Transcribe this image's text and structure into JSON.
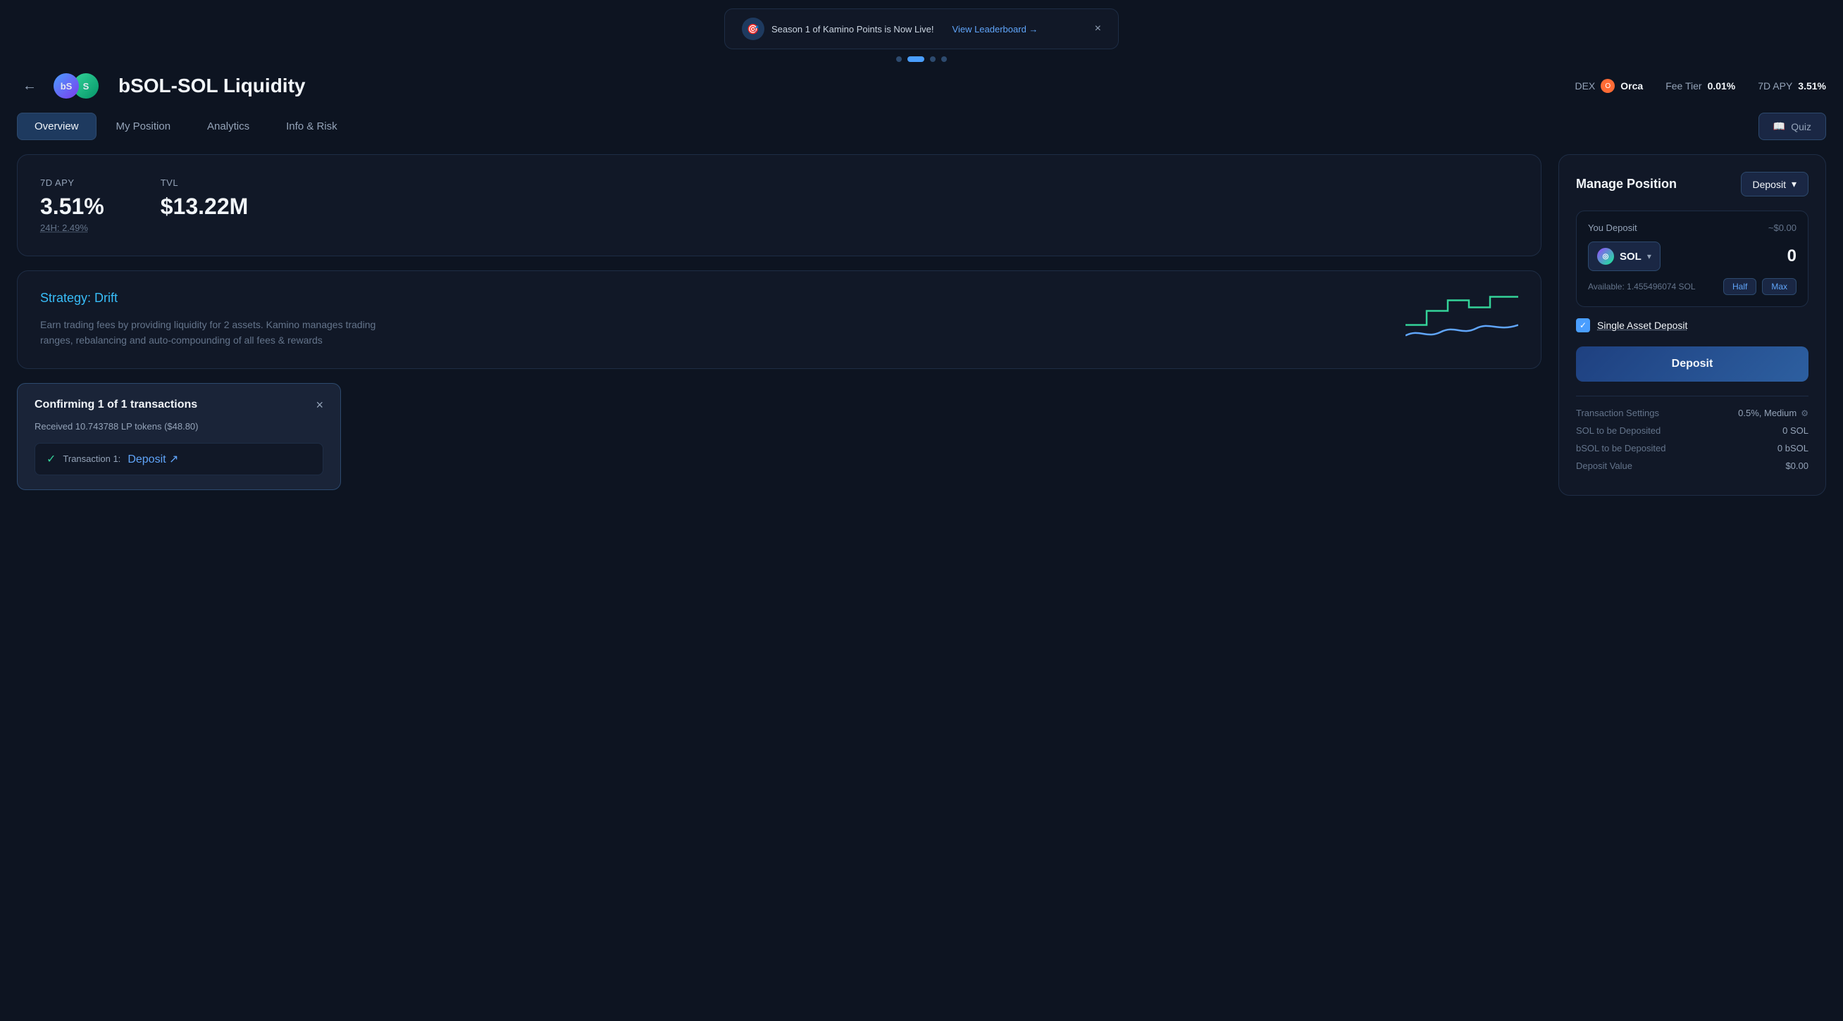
{
  "banner": {
    "text": "Season 1 of Kamino Points is Now Live!",
    "link_text": "View Leaderboard →",
    "close_label": "×",
    "icon": "🎯"
  },
  "dots": [
    {
      "active": false
    },
    {
      "active": true
    },
    {
      "active": false
    },
    {
      "active": false
    }
  ],
  "header": {
    "back_label": "←",
    "pool_title": "bSOL-SOL Liquidity",
    "dex_label": "DEX",
    "dex_name": "Orca",
    "fee_tier_label": "Fee Tier",
    "fee_tier_value": "0.01%",
    "apy_label": "7D APY",
    "apy_value": "3.51%"
  },
  "nav": {
    "tabs": [
      {
        "label": "Overview",
        "active": true
      },
      {
        "label": "My Position",
        "active": false
      },
      {
        "label": "Analytics",
        "active": false
      },
      {
        "label": "Info & Risk",
        "active": false
      }
    ],
    "quiz_label": "Quiz"
  },
  "stats": {
    "apy_label": "7D APY",
    "apy_value": "3.51%",
    "apy_sub": "24H: 2.49%",
    "tvl_label": "TVL",
    "tvl_value": "$13.22M"
  },
  "strategy": {
    "title_prefix": "Strategy: ",
    "title_highlight": "Drift",
    "description": "Earn trading fees by providing liquidity for 2 assets. Kamino manages trading ranges, rebalancing and\nauto-compounding of all fees & rewards"
  },
  "confirm_modal": {
    "title": "Confirming 1 of 1 transactions",
    "close_label": "×",
    "subtitle": "Received 10.743788 LP tokens ($48.80)",
    "tx_check": "✓",
    "tx_label": "Transaction 1:",
    "tx_link": "Deposit",
    "tx_arrow": "↗"
  },
  "manage_position": {
    "title": "Manage Position",
    "dropdown_label": "Deposit",
    "dropdown_arrow": "▾",
    "deposit_section": {
      "label": "You Deposit",
      "usd_value": "~$0.00",
      "token_name": "SOL",
      "amount": "0",
      "available_label": "Available: 1.455496074 SOL",
      "half_label": "Half",
      "max_label": "Max"
    },
    "single_asset": {
      "checked": true,
      "label": "Single Asset Deposit"
    },
    "deposit_btn_label": "Deposit",
    "tx_settings": {
      "label": "Transaction Settings",
      "value": "0.5%, Medium",
      "sol_deposited_label": "SOL to be Deposited",
      "sol_deposited_value": "0 SOL",
      "bsol_deposited_label": "bSOL to be Deposited",
      "bsol_deposited_value": "0 bSOL",
      "deposit_value_label": "Deposit Value",
      "deposit_value": "$0.00"
    }
  }
}
